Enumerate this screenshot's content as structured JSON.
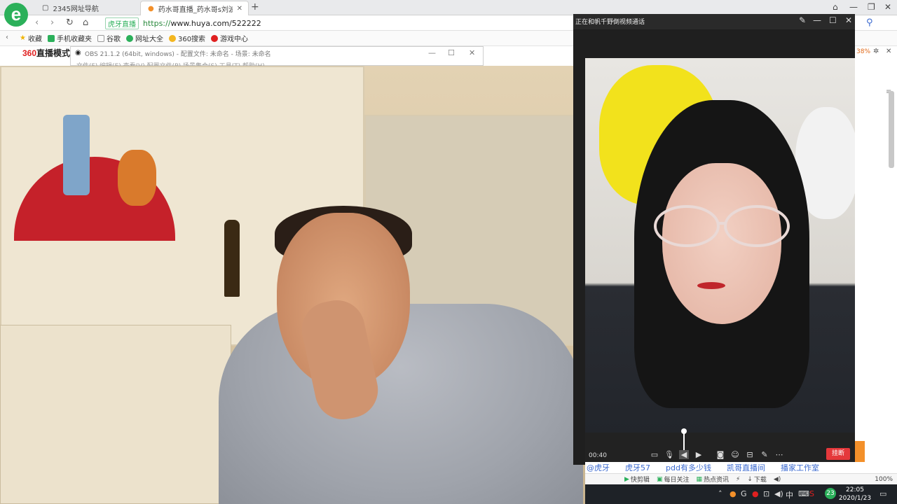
{
  "browser": {
    "tabs": [
      {
        "label": "2345网址导航",
        "active": false
      },
      {
        "label": "药水哥直播_药水哥s刘波直播间...",
        "active": true
      }
    ],
    "url_tag": "虎牙直播",
    "url_scheme": "https://",
    "url_rest": "www.huya.com/522222",
    "bookmarks": [
      "收藏",
      "手机收藏夹",
      "谷歌",
      "网址大全",
      "360搜索",
      "游戏中心"
    ],
    "page_brand_num": "360",
    "page_brand_text": "直播模式"
  },
  "obs": {
    "title": "OBS 21.1.2 (64bit, windows) - 配置文件: 未命名 - 场景: 未命名",
    "menu": "文件(F)   编辑(E)   查看(V)   配置文件(P)   场景集合(S)   工具(T)   帮助(H)"
  },
  "call": {
    "title": "正在和帆千野倒视频通话",
    "timer": "00:40",
    "hangup_label": "挂断"
  },
  "right_strip": {
    "percent": "38%"
  },
  "links": [
    "@虎牙",
    "虎牙57",
    "pdd有多少钱",
    "凯哥直播间",
    "播家工作室"
  ],
  "status": {
    "items": [
      "快剪辑",
      "每日关注",
      "热点资讯",
      "下载"
    ],
    "zoom": "100%"
  },
  "taskbar": {
    "ime": "中",
    "badge": "23",
    "time": "22:05",
    "date": "2020/1/23"
  },
  "colors": {
    "accent": "#2bb05a",
    "hangup": "#e5383b",
    "link": "#3b6ad0"
  }
}
